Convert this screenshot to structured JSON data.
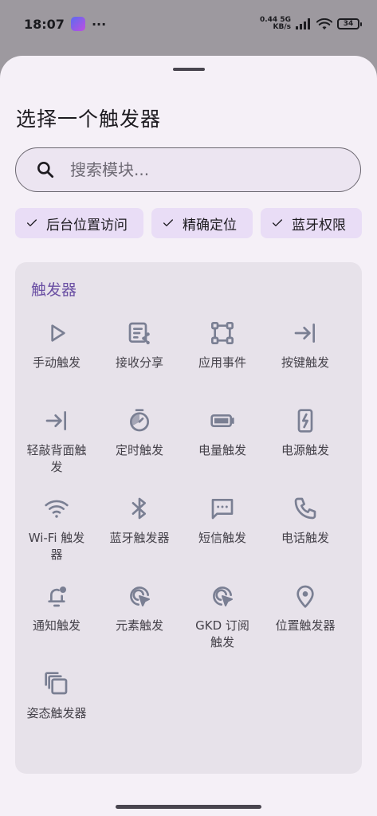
{
  "status_bar": {
    "time": "18:07",
    "dots": "···",
    "net_speed": "0.44",
    "net_unit": "KB/s",
    "network": "5G",
    "battery": "34"
  },
  "background": {
    "text": "…"
  },
  "sheet": {
    "title": "选择一个触发器",
    "search": {
      "placeholder": "搜索模块..."
    },
    "filter_chips": [
      {
        "label": "后台位置访问",
        "icon": "check-icon"
      },
      {
        "label": "精确定位",
        "icon": "check-icon"
      },
      {
        "label": "蓝牙权限",
        "icon": "check-icon"
      }
    ],
    "section": {
      "title": "触发器",
      "items": [
        {
          "label": "手动触发",
          "icon": "play-outline-icon"
        },
        {
          "label": "接收分享",
          "icon": "share-list-icon"
        },
        {
          "label": "应用事件",
          "icon": "selection-square-icon"
        },
        {
          "label": "按键触发",
          "icon": "arrow-to-line-icon"
        },
        {
          "label": "轻敲背面触发",
          "icon": "arrow-to-line-icon"
        },
        {
          "label": "定时触发",
          "icon": "timer-icon"
        },
        {
          "label": "电量触发",
          "icon": "battery-icon"
        },
        {
          "label": "电源触发",
          "icon": "charging-icon"
        },
        {
          "label": "Wi-Fi 触发器",
          "icon": "wifi-icon"
        },
        {
          "label": "蓝牙触发器",
          "icon": "bluetooth-icon"
        },
        {
          "label": "短信触发",
          "icon": "message-icon"
        },
        {
          "label": "电话触发",
          "icon": "phone-icon"
        },
        {
          "label": "通知触发",
          "icon": "notification-icon"
        },
        {
          "label": "元素触发",
          "icon": "target-cursor-icon"
        },
        {
          "label": "GKD 订阅触发",
          "icon": "target-cursor-icon"
        },
        {
          "label": "位置触发器",
          "icon": "location-pin-icon"
        },
        {
          "label": "姿态触发器",
          "icon": "copy-icon"
        }
      ]
    }
  },
  "colors": {
    "accent": "#6a4fa3",
    "icon": "#7a7f93",
    "chip_bg": "#e9ddf6",
    "panel_bg": "#e7e2ea",
    "sheet_bg": "#f5f0f7"
  }
}
